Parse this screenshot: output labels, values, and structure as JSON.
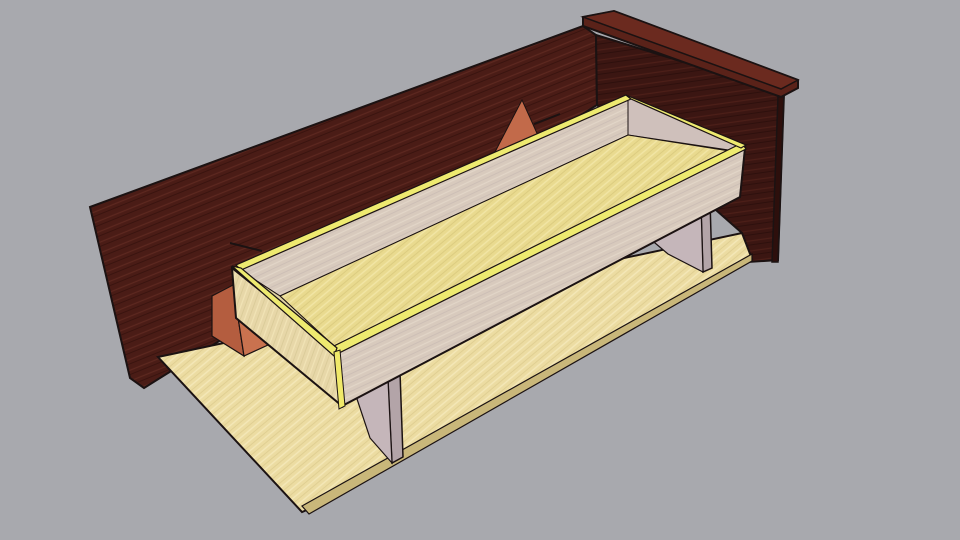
{
  "scene": {
    "subject": "3d-wooden-box-model-render",
    "colors": {
      "background": "#a8a9ae",
      "back_panel": "#4a1c16",
      "back_panel_dark": "#2d0f0c",
      "base_board": "#ecdca2",
      "tray_floor": "#e6d78e",
      "tray_walls": "#d7c9bd",
      "tray_rim": "#eeea70",
      "support": "#c2b3b7",
      "wedge": "#c26a4a",
      "edge": "#1b1212"
    }
  }
}
